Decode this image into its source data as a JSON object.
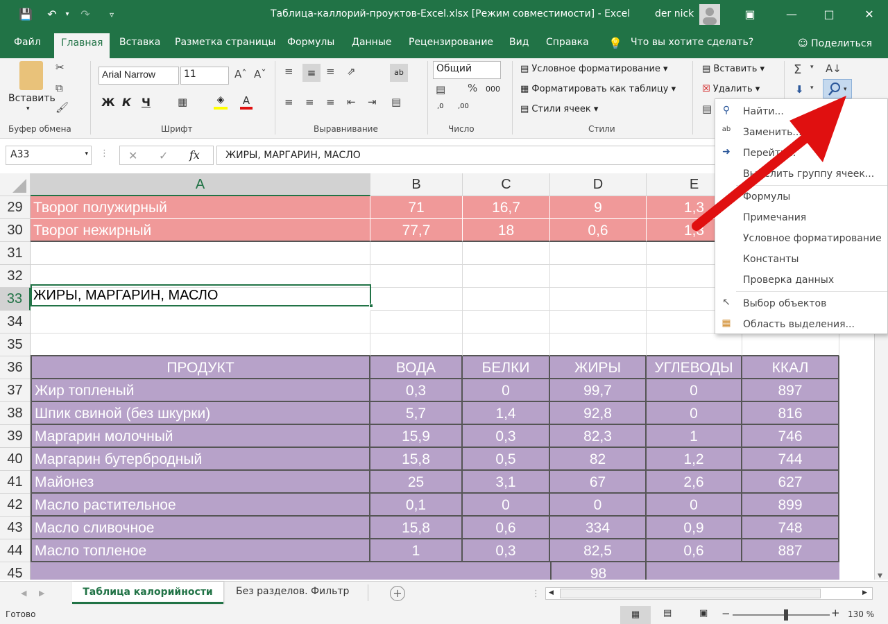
{
  "window": {
    "title": "Таблица-каллорий-проуктов-Excel.xlsx  [Режим совместимости]  -  Excel",
    "user": "der nick"
  },
  "ribbon_tabs": [
    "Файл",
    "Главная",
    "Вставка",
    "Разметка страницы",
    "Формулы",
    "Данные",
    "Рецензирование",
    "Вид",
    "Справка"
  ],
  "tell_me": "Что вы хотите сделать?",
  "share": "Поделиться",
  "ribbon": {
    "paste_label": "Вставить",
    "clipboard_label": "Буфер обмена",
    "font_name": "Arial Narrow",
    "font_size": "11",
    "bold": "Ж",
    "italic": "К",
    "underline": "Ч",
    "font_label": "Шрифт",
    "alignment_label": "Выравнивание",
    "number_format": "Общий",
    "number_label": "Число",
    "cond_format": "Условное форматирование",
    "format_table": "Форматировать как таблицу",
    "cell_styles": "Стили ячеек",
    "styles_label": "Стили",
    "insert": "Вставить",
    "delete": "Удалить"
  },
  "formula_bar": {
    "name_box": "A33",
    "fx": "fx",
    "content": "ЖИРЫ, МАРГАРИН, МАСЛО"
  },
  "columns": [
    "A",
    "B",
    "C",
    "D",
    "E"
  ],
  "rows": {
    "r29": {
      "num": "29",
      "a": "Творог полужирный",
      "b": "71",
      "c": "16,7",
      "d": "9",
      "e": "1,3"
    },
    "r30": {
      "num": "30",
      "a": "Творог нежирный",
      "b": "77,7",
      "c": "18",
      "d": "0,6",
      "e": "1,3"
    },
    "r31": {
      "num": "31"
    },
    "r32": {
      "num": "32"
    },
    "r33": {
      "num": "33",
      "a": "ЖИРЫ, МАРГАРИН, МАСЛО"
    },
    "r34": {
      "num": "34"
    },
    "r35": {
      "num": "35"
    },
    "r36": {
      "num": "36",
      "a": "ПРОДУКТ",
      "b": "ВОДА",
      "c": "БЕЛКИ",
      "d": "ЖИРЫ",
      "e": "УГЛЕВОДЫ",
      "f": "ККАЛ"
    },
    "r37": {
      "num": "37",
      "a": "Жир топленый",
      "b": "0,3",
      "c": "0",
      "d": "99,7",
      "e": "0",
      "f": "897"
    },
    "r38": {
      "num": "38",
      "a": "Шпик свиной (без шкурки)",
      "b": "5,7",
      "c": "1,4",
      "d": "92,8",
      "e": "0",
      "f": "816"
    },
    "r39": {
      "num": "39",
      "a": "Маргарин молочный",
      "b": "15,9",
      "c": "0,3",
      "d": "82,3",
      "e": "1",
      "f": "746"
    },
    "r40": {
      "num": "40",
      "a": "Маргарин бутербродный",
      "b": "15,8",
      "c": "0,5",
      "d": "82",
      "e": "1,2",
      "f": "744"
    },
    "r41": {
      "num": "41",
      "a": "Майонез",
      "b": "25",
      "c": "3,1",
      "d": "67",
      "e": "2,6",
      "f": "627"
    },
    "r42": {
      "num": "42",
      "a": "Масло растительное",
      "b": "0,1",
      "c": "0",
      "d": "0",
      "e": "0",
      "f": "899"
    },
    "r43": {
      "num": "43",
      "a": "Масло сливочное",
      "b": "15,8",
      "c": "0,6",
      "d": "334",
      "e": "0,9",
      "f": "748"
    },
    "r44": {
      "num": "44",
      "a": "Масло топленое",
      "b": "1",
      "c": "0,3",
      "d": "82,5",
      "e": "0,6",
      "f": "887"
    },
    "r45": {
      "num": "45",
      "d": "98"
    }
  },
  "sheet_tabs": [
    "Таблица калорийности",
    "Без разделов. Фильтр"
  ],
  "status": {
    "ready": "Готово",
    "zoom": "130 %"
  },
  "dropdown": {
    "items": [
      "Найти...",
      "Заменить...",
      "Перейти...",
      "Выделить группу ячеек...",
      "Формулы",
      "Примечания",
      "Условное форматирование",
      "Константы",
      "Проверка данных",
      "Выбор объектов",
      "Область выделения..."
    ]
  },
  "colors": {
    "excel_green": "#217346",
    "pink": "#f09999",
    "purple": "#b7a2c9",
    "arrow": "#e01010"
  }
}
